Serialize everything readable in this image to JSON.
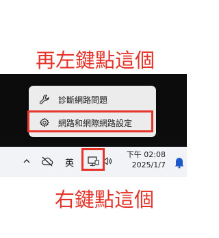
{
  "annotations": {
    "top_text": "再左鍵點這個",
    "bottom_text": "右鍵點這個",
    "color": "#e5332a"
  },
  "context_menu": {
    "items": [
      {
        "label": "診斷網路問題",
        "icon": "wrench-icon"
      },
      {
        "label": "網路和網際網路設定",
        "icon": "gear-icon"
      }
    ]
  },
  "taskbar": {
    "tray_icons": [
      "chevron-up-icon",
      "cloud-off-icon",
      "network-icon",
      "volume-icon",
      "notification-icon"
    ],
    "ime_label": "英",
    "clock_time": "下午 02:08",
    "clock_date": "2025/1/7"
  }
}
